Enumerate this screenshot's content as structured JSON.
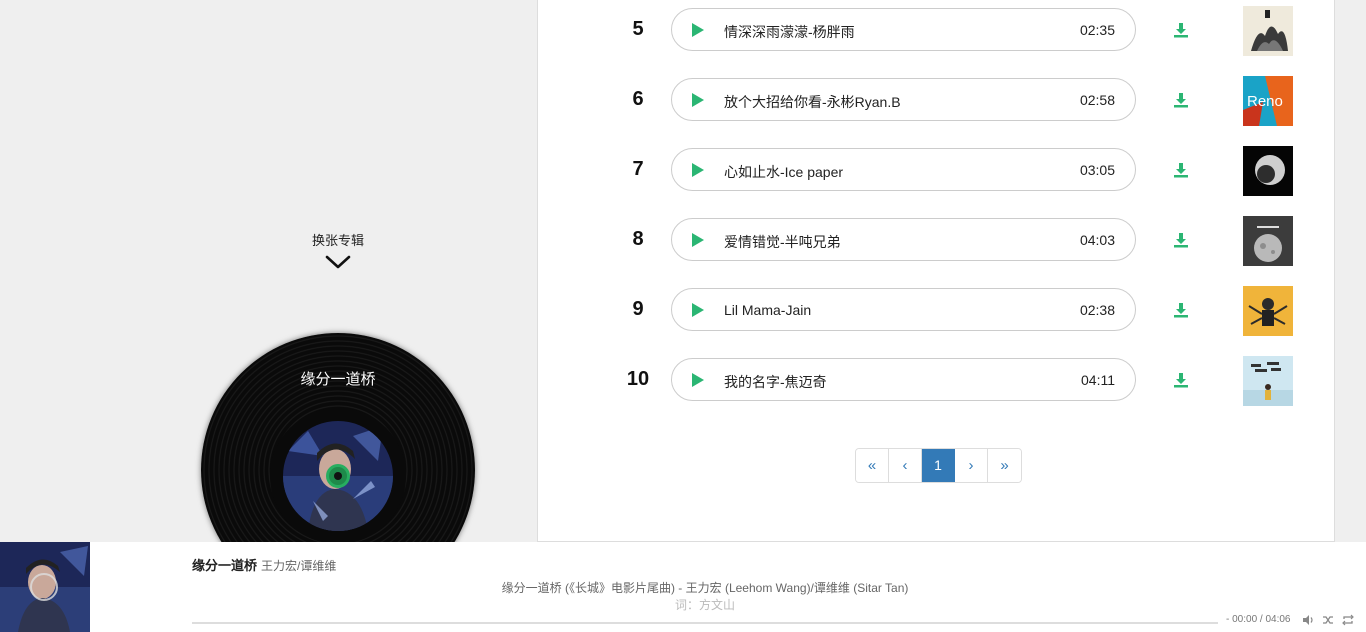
{
  "left": {
    "switch_album_label": "换张专辑",
    "vinyl_title": "缘分一道桥"
  },
  "songs": [
    {
      "num": "5",
      "title": "情深深雨濛濛-杨胖雨",
      "duration": "02:35",
      "thumb_icon": "album-art-ink-painting"
    },
    {
      "num": "6",
      "title": "放个大招给你看-永彬Ryan.B",
      "duration": "02:58",
      "thumb_icon": "album-art-reno",
      "thumb_text": "Reno"
    },
    {
      "num": "7",
      "title": "心如止水-Ice paper",
      "duration": "03:05",
      "thumb_icon": "album-art-moon-dark"
    },
    {
      "num": "8",
      "title": "爱情错觉-半吨兄弟",
      "duration": "04:03",
      "thumb_icon": "album-art-moon-grey"
    },
    {
      "num": "9",
      "title": "Lil Mama-Jain",
      "duration": "02:38",
      "thumb_icon": "album-art-yellow-figure"
    },
    {
      "num": "10",
      "title": "我的名字-焦迈奇",
      "duration": "04:11",
      "thumb_icon": "album-art-sky-name"
    }
  ],
  "pagination": {
    "first": "«",
    "prev": "‹",
    "current": "1",
    "next": "›",
    "last": "»"
  },
  "player": {
    "title": "缘分一道桥",
    "artist": "王力宏/谭维维",
    "lyric_line1": "缘分一道桥 (《长城》电影片尾曲) - 王力宏 (Leehom Wang)/谭维维 (Sitar Tan)",
    "lyric_line2": "词：方文山",
    "time": "- 00:00 / 04:06",
    "progress": 0
  },
  "colors": {
    "accent_green": "#2bb673",
    "pager_blue": "#337ab7"
  }
}
